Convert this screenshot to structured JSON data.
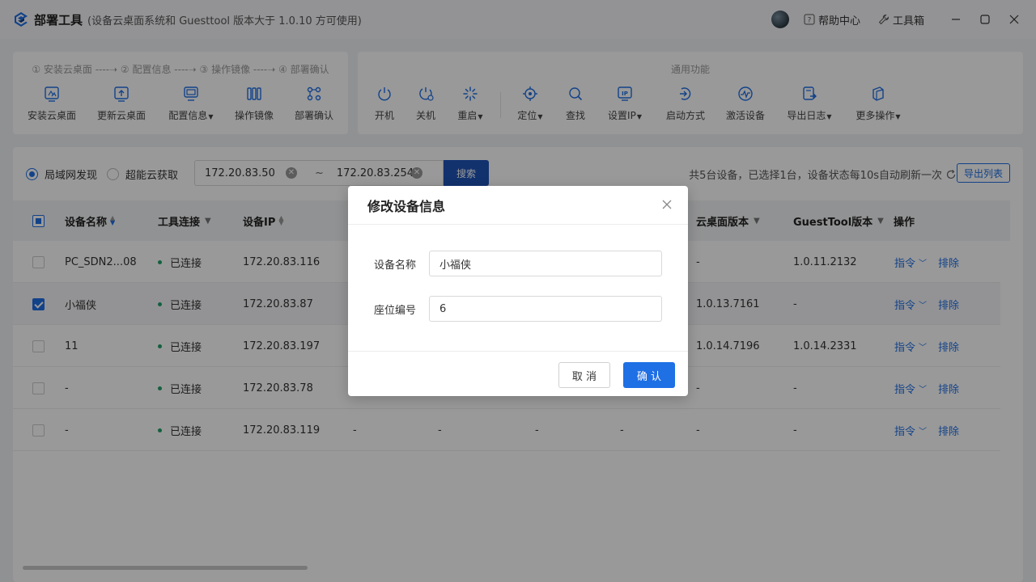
{
  "titlebar": {
    "title": "部署工具",
    "subtitle": "(设备云桌面系统和 Guesttool 版本大于 1.0.10 方可使用)",
    "help_label": "帮助中心",
    "toolbox_label": "工具箱"
  },
  "deploy_panel": {
    "steps": "① 安装云桌面 ----➝ ② 配置信息 ----➝ ③ 操作镜像 ----➝ ④ 部署确认",
    "tools": [
      {
        "label": "安装云桌面",
        "icon": "install-desktop-icon"
      },
      {
        "label": "更新云桌面",
        "icon": "update-desktop-icon"
      },
      {
        "label": "配置信息",
        "icon": "config-info-icon",
        "dropdown": true
      },
      {
        "label": "操作镜像",
        "icon": "image-icon"
      },
      {
        "label": "部署确认",
        "icon": "deploy-confirm-icon"
      }
    ]
  },
  "common_panel": {
    "title": "通用功能",
    "tools": [
      {
        "label": "开机",
        "icon": "power-on-icon"
      },
      {
        "label": "关机",
        "icon": "power-off-icon"
      },
      {
        "label": "重启",
        "icon": "restart-icon",
        "dropdown": true
      },
      {
        "label": "定位",
        "icon": "locate-icon",
        "dropdown": true
      },
      {
        "label": "查找",
        "icon": "search-icon"
      },
      {
        "label": "设置IP",
        "icon": "set-ip-icon",
        "dropdown": true
      },
      {
        "label": "启动方式",
        "icon": "boot-mode-icon"
      },
      {
        "label": "激活设备",
        "icon": "activate-icon"
      },
      {
        "label": "导出日志",
        "icon": "export-log-icon",
        "dropdown": true
      },
      {
        "label": "更多操作",
        "icon": "more-ops-icon",
        "dropdown": true
      }
    ]
  },
  "filter": {
    "radio_lan": "局域网发现",
    "radio_cloud": "超能云获取",
    "ip_start": "172.20.83.50",
    "ip_sep": "~",
    "ip_end": "172.20.83.254",
    "search_label": "搜索",
    "summary": "共5台设备，已选择1台，设备状态每10s自动刷新一次",
    "export_label": "导出列表"
  },
  "table": {
    "headers": {
      "name": "设备名称",
      "conn": "工具连接",
      "ip": "设备IP",
      "desktop_ver": "云桌面版本",
      "guest_ver": "GuestTool版本",
      "ops": "操作"
    },
    "rows": [
      {
        "name": "PC_SDN2...08",
        "conn": "已连接",
        "ip": "172.20.83.116",
        "c4": "",
        "c5": "",
        "c6": "",
        "c7": "",
        "desktop_ver": "-",
        "guest_ver": "1.0.11.2132",
        "checked": false
      },
      {
        "name": "小福侠",
        "conn": "已连接",
        "ip": "172.20.83.87",
        "c4": "",
        "c5": "",
        "c6": "",
        "c7": "",
        "desktop_ver": "1.0.13.7161",
        "guest_ver": "-",
        "checked": true
      },
      {
        "name": "11",
        "conn": "已连接",
        "ip": "172.20.83.197",
        "c4": "",
        "c5": "",
        "c6": "",
        "c7": "",
        "desktop_ver": "1.0.14.7196",
        "guest_ver": "1.0.14.2331",
        "checked": false
      },
      {
        "name": "-",
        "conn": "已连接",
        "ip": "172.20.83.78",
        "c4": "",
        "c5": "",
        "c6": "",
        "c7": "",
        "desktop_ver": "-",
        "guest_ver": "-",
        "checked": false
      },
      {
        "name": "-",
        "conn": "已连接",
        "ip": "172.20.83.119",
        "c4": "-",
        "c5": "-",
        "c6": "-",
        "c7": "-",
        "desktop_ver": "-",
        "guest_ver": "-",
        "checked": false
      }
    ],
    "action_cmd": "指令",
    "action_exclude": "排除"
  },
  "modal": {
    "title": "修改设备信息",
    "name_label": "设备名称",
    "name_value": "小福侠",
    "seat_label": "座位编号",
    "seat_value": "6",
    "cancel_label": "取 消",
    "ok_label": "确 认"
  },
  "colors": {
    "accent": "#1f6fe5",
    "search_button": "#1f54b8",
    "connected_dot": "#22a06b"
  }
}
